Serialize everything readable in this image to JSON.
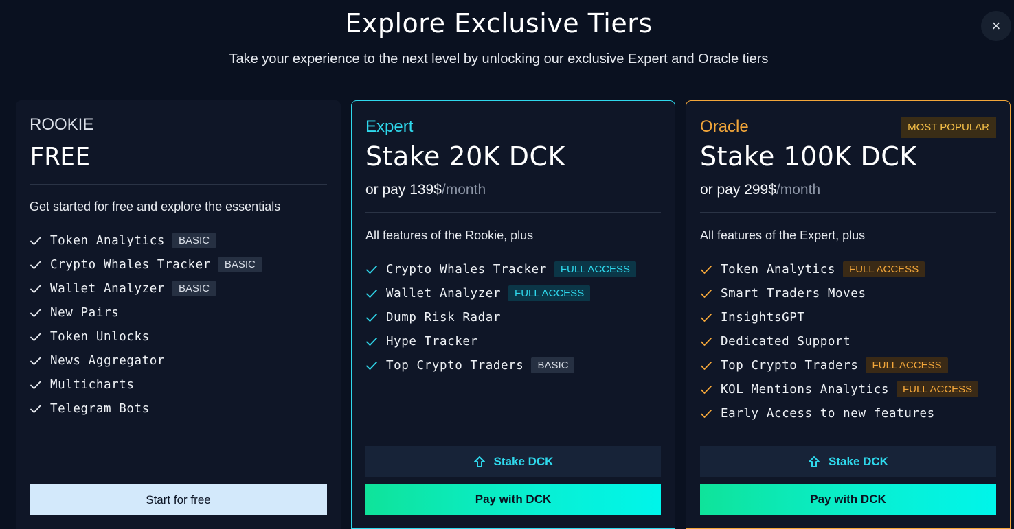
{
  "header": {
    "title": "Explore Exclusive Tiers",
    "subtitle": "Take your experience to the next level by unlocking our exclusive Expert and Oracle tiers",
    "close_icon": "×"
  },
  "colors": {
    "background": "#0a1120",
    "card": "#0f1627",
    "expert_accent": "#2fd8ec",
    "oracle_accent": "#f2a63a",
    "pay_gradient_start": "#0fe39a",
    "pay_gradient_end": "#00f5ea"
  },
  "rookie": {
    "tier": "ROOKIE",
    "price": "FREE",
    "description": "Get started for free and explore the essentials",
    "features": [
      {
        "text": "Token Analytics",
        "badge": "BASIC"
      },
      {
        "text": "Crypto Whales Tracker",
        "badge": "BASIC"
      },
      {
        "text": "Wallet Analyzer",
        "badge": "BASIC"
      },
      {
        "text": "New Pairs",
        "badge": ""
      },
      {
        "text": "Token Unlocks",
        "badge": ""
      },
      {
        "text": "News Aggregator",
        "badge": ""
      },
      {
        "text": "Multicharts",
        "badge": ""
      },
      {
        "text": "Telegram Bots",
        "badge": ""
      }
    ],
    "button": "Start for free"
  },
  "expert": {
    "tier": "Expert",
    "price": "Stake 20K DCK",
    "alt_prefix": "or pay 139$",
    "alt_suffix": "/month",
    "description": "All features of the Rookie, plus",
    "features": [
      {
        "text": "Crypto Whales Tracker",
        "badge": "FULL ACCESS"
      },
      {
        "text": "Wallet Analyzer",
        "badge": "FULL ACCESS"
      },
      {
        "text": "Dump Risk Radar",
        "badge": ""
      },
      {
        "text": "Hype Tracker",
        "badge": ""
      },
      {
        "text": "Top Crypto Traders",
        "badge": "BASIC"
      }
    ],
    "stake_button": "Stake DCK",
    "pay_button": "Pay with DCK"
  },
  "oracle": {
    "tier": "Oracle",
    "popular_badge": "MOST POPULAR",
    "price": "Stake 100K DCK",
    "alt_prefix": "or pay 299$",
    "alt_suffix": "/month",
    "description": "All features of the Expert, plus",
    "features": [
      {
        "text": "Token Analytics",
        "badge": "FULL ACCESS"
      },
      {
        "text": "Smart Traders Moves",
        "badge": ""
      },
      {
        "text": "InsightsGPT",
        "badge": ""
      },
      {
        "text": "Dedicated Support",
        "badge": ""
      },
      {
        "text": "Top Crypto Traders",
        "badge": "FULL ACCESS"
      },
      {
        "text": "KOL Mentions Analytics",
        "badge": "FULL ACCESS"
      },
      {
        "text": "Early Access to new features",
        "badge": ""
      }
    ],
    "stake_button": "Stake DCK",
    "pay_button": "Pay with DCK"
  }
}
